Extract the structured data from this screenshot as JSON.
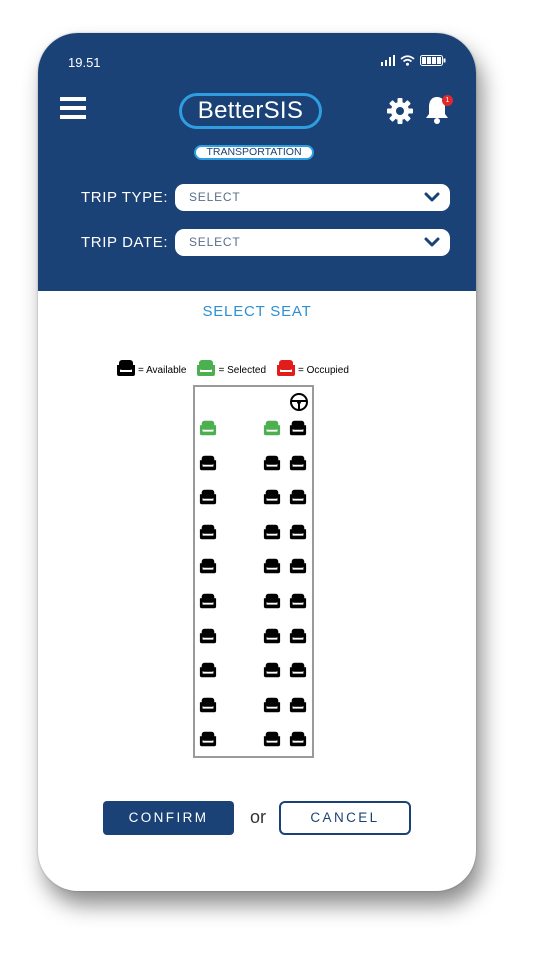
{
  "status_bar": {
    "time": "19.51"
  },
  "header": {
    "logo": "BetterSIS",
    "subtitle": "TRANSPORTATION",
    "notification_count": "1",
    "icons": [
      "menu-icon",
      "gear-icon",
      "bell-icon"
    ]
  },
  "form": {
    "trip_type_label": "TRIP TYPE:",
    "trip_type_value": "SELECT",
    "trip_date_label": "TRIP DATE:",
    "trip_date_value": "SELECT"
  },
  "seat_section": {
    "title": "SELECT SEAT",
    "legend": [
      {
        "label": "= Available",
        "color": "#000000"
      },
      {
        "label": "= Selected",
        "color": "#4caf50"
      },
      {
        "label": "= Occupied",
        "color": "#e21b1b"
      }
    ],
    "rows": [
      [
        "selected",
        "selected",
        "available"
      ],
      [
        "available",
        "available",
        "available"
      ],
      [
        "available",
        "available",
        "available"
      ],
      [
        "available",
        "available",
        "available"
      ],
      [
        "available",
        "available",
        "available"
      ],
      [
        "available",
        "available",
        "available"
      ],
      [
        "available",
        "available",
        "available"
      ],
      [
        "available",
        "available",
        "available"
      ],
      [
        "available",
        "available",
        "available"
      ],
      [
        "available",
        "available",
        "available"
      ]
    ]
  },
  "actions": {
    "confirm": "CONFIRM",
    "or": "or",
    "cancel": "CANCEL"
  },
  "colors": {
    "header_bg": "#1b4276",
    "accent": "#2f9ee0",
    "available": "#000000",
    "selected": "#4caf50",
    "occupied": "#e21b1b"
  }
}
